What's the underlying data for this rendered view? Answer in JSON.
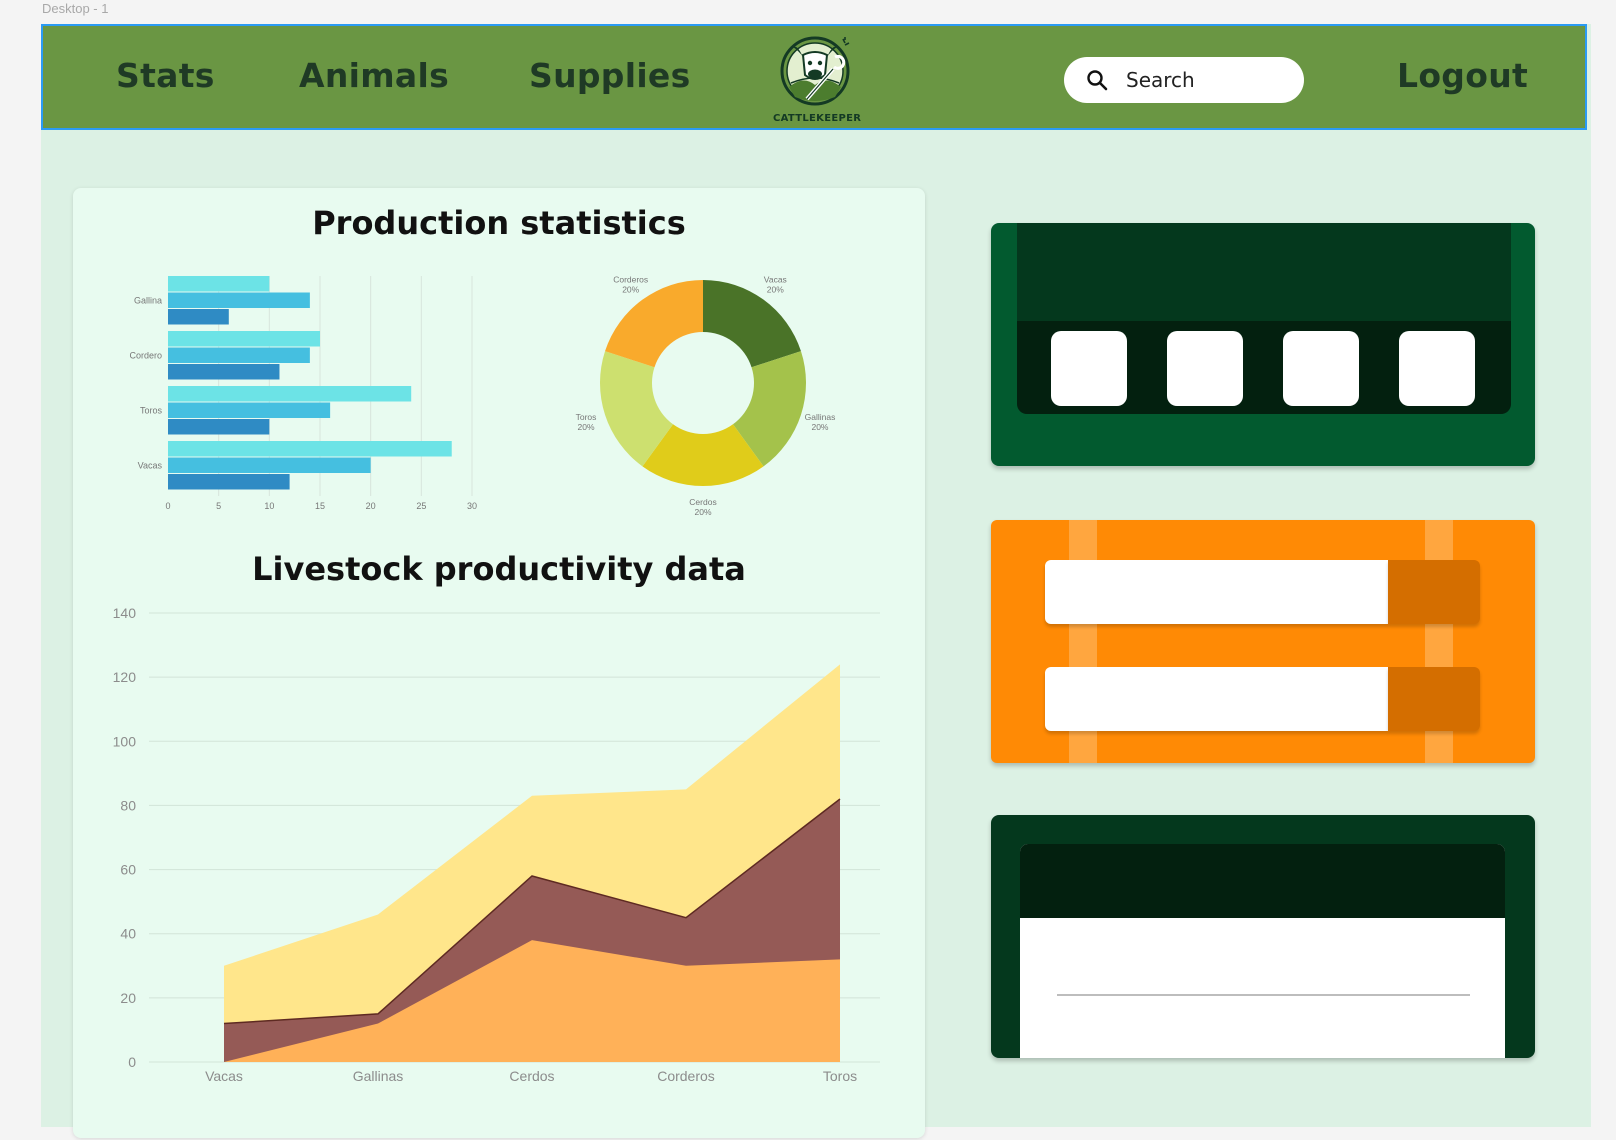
{
  "frame_label": "Desktop - 1",
  "nav": {
    "links": [
      "Stats",
      "Animals",
      "Supplies"
    ],
    "logout": "Logout",
    "logo_text": "CATTLEKEEPER",
    "search_placeholder": "Search"
  },
  "colors": {
    "navbar": "#6a9643",
    "canvas": "#dcf1e4",
    "panel": "#e8fbf0",
    "card_green": "#025a2f",
    "card_orange": "#ff8a05",
    "card_dark": "#04381d"
  },
  "stats": {
    "production_title": "Production statistics",
    "productivity_title": "Livestock productivity data"
  },
  "chart_data": [
    {
      "type": "bar",
      "orientation": "horizontal",
      "categories": [
        "Gallina",
        "Cordero",
        "Toros",
        "Vacas"
      ],
      "series": [
        {
          "values": [
            10,
            15,
            24,
            28
          ],
          "color": "#6ce3e6"
        },
        {
          "values": [
            14,
            14,
            16,
            20
          ],
          "color": "#45bfe0"
        },
        {
          "values": [
            6,
            11,
            10,
            12
          ],
          "color": "#2f8bc4"
        }
      ],
      "xticks": [
        0,
        5,
        10,
        15,
        20,
        25,
        30
      ],
      "xlim": [
        0,
        30
      ],
      "grid": true
    },
    {
      "type": "pie",
      "donut": true,
      "slices": [
        {
          "label": "Vacas",
          "pct_label": "20%",
          "value": 20,
          "color": "#4a7328"
        },
        {
          "label": "Gallinas",
          "pct_label": "20%",
          "value": 20,
          "color": "#a4c24b"
        },
        {
          "label": "Cerdos",
          "pct_label": "20%",
          "value": 20,
          "color": "#e0cc1a"
        },
        {
          "label": "Toros",
          "pct_label": "20%",
          "value": 20,
          "color": "#cde06f"
        },
        {
          "label": "Corderos",
          "pct_label": "20%",
          "value": 20,
          "color": "#f9aa2c"
        }
      ]
    },
    {
      "type": "area",
      "stacked": true,
      "categories": [
        "Vacas",
        "Gallinas",
        "Cerdos",
        "Corderos",
        "Toros"
      ],
      "series": [
        {
          "values": [
            0,
            12,
            38,
            30,
            32
          ],
          "color": "#ffb158"
        },
        {
          "values": [
            12,
            15,
            58,
            45,
            82
          ],
          "color": "#955a56"
        },
        {
          "values": [
            30,
            46,
            83,
            85,
            124
          ],
          "color": "#ffe68b"
        }
      ],
      "yticks": [
        0,
        20,
        40,
        60,
        80,
        100,
        120,
        140
      ],
      "ylim": [
        0,
        140
      ],
      "grid": true
    }
  ]
}
